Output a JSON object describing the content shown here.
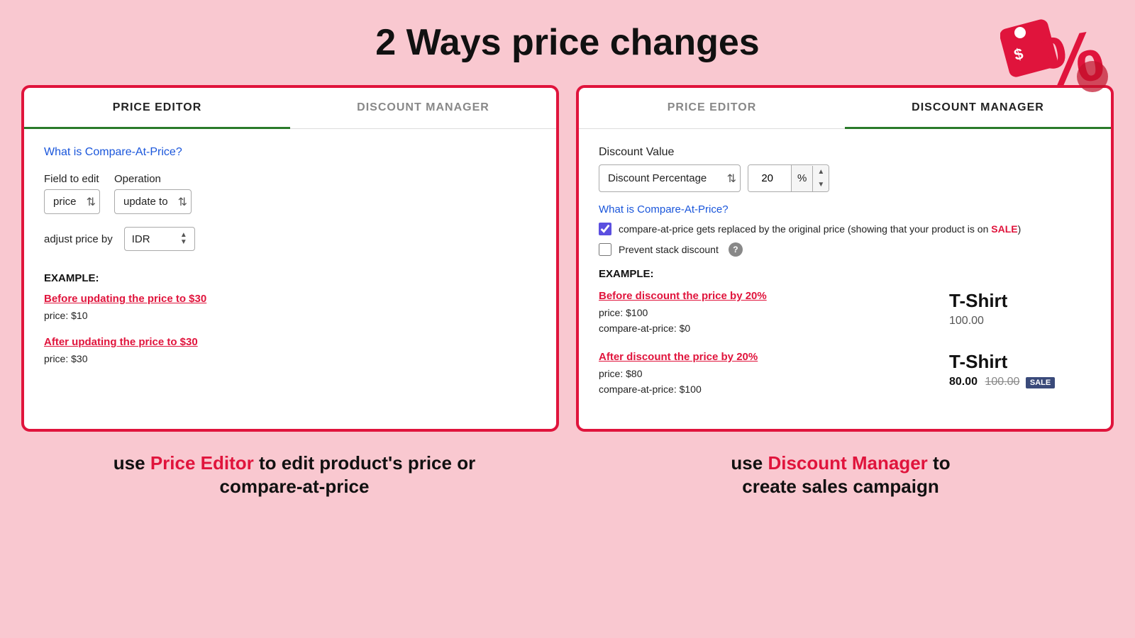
{
  "page": {
    "title": "2 Ways price changes",
    "background_color": "#f9c8d0"
  },
  "left_panel": {
    "tab_price_editor": "PRICE EDITOR",
    "tab_discount_manager": "DISCOUNT MANAGER",
    "what_link": "What is Compare-At-Price?",
    "field_label": "Field to edit",
    "field_value": "price",
    "operation_label": "Operation",
    "operation_value": "update to",
    "adjust_label": "adjust price by",
    "adjust_value": "IDR",
    "example_label": "EXAMPLE:",
    "before_title": "Before updating the price to $30",
    "before_price": "price:   $10",
    "after_title": "After updating the price to $30",
    "after_price": "price:   $30"
  },
  "right_panel": {
    "tab_price_editor": "PRICE EDITOR",
    "tab_discount_manager": "DISCOUNT MANAGER",
    "discount_value_label": "Discount Value",
    "discount_type": "Discount Percentage",
    "discount_amount": "20",
    "discount_unit": "%",
    "what_link": "What is Compare-At-Price?",
    "cap_checkbox_label": "compare-at-price gets replaced by the original price (showing that your product is on ",
    "sale_text": "SALE",
    "sale_end": ")",
    "prevent_label": "Prevent stack discount",
    "example_label": "EXAMPLE:",
    "before_discount_title": "Before discount the price by 20%",
    "before_price": "price:   $100",
    "before_cap": "compare-at-price:   $0",
    "after_discount_title": "After discount the price by 20%",
    "after_price": "price:   $80",
    "after_cap": "compare-at-price:   $100",
    "product_name": "T-Shirt",
    "product_price_before": "100.00",
    "product_price_sale_new": "80.00",
    "product_price_sale_old": "100.00",
    "sale_badge": "SALE"
  },
  "footer": {
    "left_plain1": "use ",
    "left_highlight": "Price Editor",
    "left_plain2": " to edit product's price or",
    "left_plain3": "compare-at-price",
    "right_plain1": "use ",
    "right_highlight": "Discount Manager",
    "right_plain2": " to",
    "right_plain3": "create sales campaign"
  }
}
